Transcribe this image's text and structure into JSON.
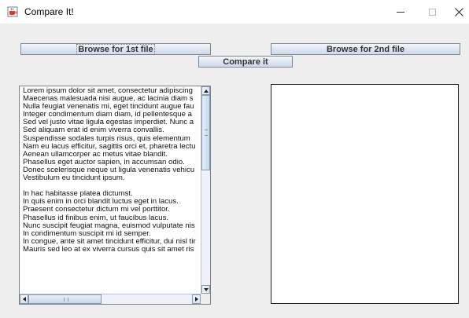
{
  "window": {
    "title": "Compare It!",
    "app_icon": "java-coffee-cup-icon",
    "controls": [
      "minimize-icon",
      "maximize-icon",
      "close-icon"
    ]
  },
  "buttons": {
    "browse_first": "Browse for 1st file",
    "browse_second": "Browse for 2nd file",
    "compare": "Compare it"
  },
  "left_text": {
    "lines": [
      "Lorem ipsum dolor sit amet, consectetur adipiscing",
      "Maecenas malesuada nisi augue, ac lacinia diam s",
      "Nulla feugiat venenatis mi, eget tincidunt augue fau",
      "Integer condimentum diam diam, id pellentesque a",
      "Sed vel justo vitae ligula egestas imperdiet. Nunc a",
      "Sed aliquam erat id enim viverra convallis.",
      "Suspendisse sodales turpis risus, quis elementum",
      "Nam eu lacus efficitur, sagittis orci et, pharetra lectu",
      "Aenean ullamcorper ac metus vitae blandit.",
      "Phasellus eget auctor sapien, in accumsan odio.",
      "Donec scelerisque neque ut ligula venenatis vehicu",
      "Vestibulum eu tincidunt ipsum.",
      "",
      "In hac habitasse platea dictumst.",
      "In quis enim in orci blandit luctus eget in lacus.",
      "Praesent consectetur dictum mi vel porttitor.",
      "Phasellus id finibus enim, ut faucibus lacus.",
      "Nunc suscipit feugiat magna, euismod vulputate nis",
      "In condimentum suscipit mi id semper.",
      "In congue, ante sit amet tincidunt efficitur, dui nisl tir",
      "Mauris sed leo at ex viverra cursus quis sit amet ris"
    ]
  },
  "right_text": {
    "content": ""
  },
  "colors": {
    "window_bg": "#eeeeee",
    "titlebar_bg": "#ffffff",
    "button_border": "#7a8a9e",
    "text": "#111111"
  }
}
